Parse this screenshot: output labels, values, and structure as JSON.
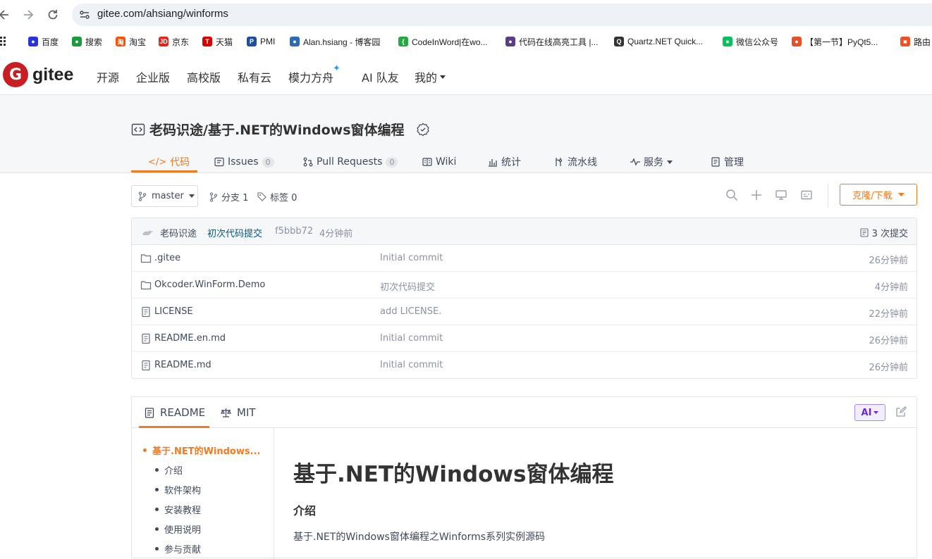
{
  "browser": {
    "url": "gitee.com/ahsiang/winforms",
    "bookmarks": [
      {
        "label": "百度",
        "icon": "baidu-icon",
        "color": "#2932e1",
        "glyph": "●"
      },
      {
        "label": "搜索",
        "icon": "search-engine-icon",
        "color": "#1a9c3c",
        "glyph": "●"
      },
      {
        "label": "淘宝",
        "icon": "taobao-icon",
        "color": "#ff5000",
        "glyph": "淘"
      },
      {
        "label": "京东",
        "icon": "jd-icon",
        "color": "#e1251b",
        "glyph": "JD"
      },
      {
        "label": "天猫",
        "icon": "tmall-icon",
        "color": "#d90000",
        "glyph": "T"
      },
      {
        "label": "PMI",
        "icon": "pmi-icon",
        "color": "#1f4e9e",
        "glyph": "P"
      },
      {
        "label": "Alan.hsiang - 博客园",
        "icon": "cnblogs-icon",
        "color": "#2d6bb5",
        "glyph": "●"
      },
      {
        "label": "CodeInWord|在wo...",
        "icon": "codeinword-icon",
        "color": "#28a745",
        "glyph": "{"
      },
      {
        "label": "代码在线高亮工具 |...",
        "icon": "highlight-tool-icon",
        "color": "#5b3c88",
        "glyph": "●"
      },
      {
        "label": "Quartz.NET Quick...",
        "icon": "quartz-icon",
        "color": "#333333",
        "glyph": "Q"
      },
      {
        "label": "微信公众号",
        "icon": "wechat-icon",
        "color": "#07c160",
        "glyph": "●"
      },
      {
        "label": "【第一节】PyQt5...",
        "icon": "pyqt-icon",
        "color": "#e8502a",
        "glyph": "●"
      },
      {
        "label": "路由",
        "icon": "microsoft-icon",
        "color": "#f25022",
        "glyph": "■"
      }
    ]
  },
  "header": {
    "logo_text": "gitee",
    "logo_glyph": "G",
    "nav": [
      "开源",
      "企业版",
      "高校版",
      "私有云",
      "模力方舟",
      "AI 队友",
      "我的"
    ]
  },
  "repo": {
    "title": "老码识途/基于.NET的Windows窗体编程",
    "tabs": [
      {
        "label": "代码",
        "count": null
      },
      {
        "label": "Issues",
        "count": "0"
      },
      {
        "label": "Pull Requests",
        "count": "0"
      },
      {
        "label": "Wiki",
        "count": null
      },
      {
        "label": "统计",
        "count": null
      },
      {
        "label": "流水线",
        "count": null
      },
      {
        "label": "服务",
        "count": null
      },
      {
        "label": "管理",
        "count": null
      }
    ]
  },
  "branch_bar": {
    "branch": "master",
    "branches": "分支 1",
    "tags": "标签 0",
    "clone_label": "克隆/下载"
  },
  "commit": {
    "author": "老码识途",
    "message": "初次代码提交",
    "hash": "f5bbb72",
    "time": "4分钟前",
    "total": "3 次提交"
  },
  "files": [
    {
      "type": "folder",
      "name": ".gitee",
      "message": "Initial commit",
      "time": "26分钟前"
    },
    {
      "type": "folder",
      "name": "Okcoder.WinForm.Demo",
      "message": "初次代码提交",
      "time": "4分钟前"
    },
    {
      "type": "file",
      "name": "LICENSE",
      "message": "add LICENSE.",
      "time": "22分钟前"
    },
    {
      "type": "file",
      "name": "README.en.md",
      "message": "Initial commit",
      "time": "26分钟前"
    },
    {
      "type": "file",
      "name": "README.md",
      "message": "Initial commit",
      "time": "26分钟前"
    }
  ],
  "readme": {
    "tab_readme": "README",
    "tab_license": "MIT",
    "ai_label": "AI",
    "toc": [
      "基于.NET的Windows...",
      "介绍",
      "软件架构",
      "安装教程",
      "使用说明",
      "参与贡献"
    ],
    "h1": "基于.NET的Windows窗体编程",
    "h2": "介绍",
    "paragraph": "基于.NET的Windows窗体编程之Winforms系列实例源码"
  },
  "colors": {
    "accent": "#f27a20",
    "brand": "#c71d23"
  }
}
